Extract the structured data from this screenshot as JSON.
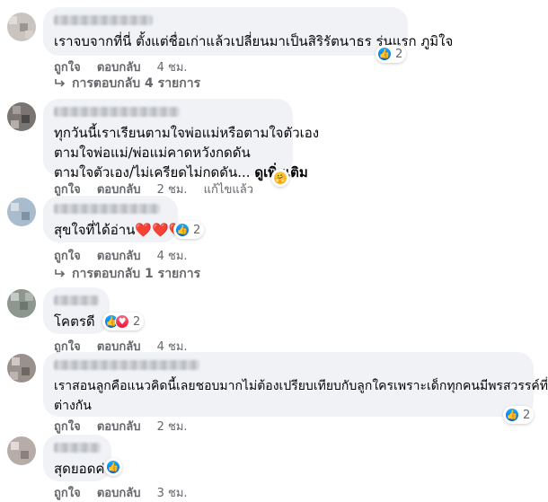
{
  "comments": [
    {
      "lines": [
        "เราจบจากที่นี่ ตั้งแต่ชื่อเก่าแล้วเปลี่ยนมาเป็นสิริรัตนาธร รุ่นแรก ภูมิใจ"
      ],
      "see_more": "",
      "reactions": {
        "icons": [
          "like"
        ],
        "count": "2"
      },
      "like": "ถูกใจ",
      "reply": "ตอบกลับ",
      "time": "4 ชม.",
      "edited": "",
      "replies": "การตอบกลับ 4 รายการ"
    },
    {
      "lines": [
        "ทุกวันนี้เราเรียนตามใจพ่อแม่หรือตามใจตัวเอง",
        "ตามใจพ่อแม่/พ่อแม่คาดหวังกดดัน",
        "ตามใจตัวเอง/ไม่เครียดไม่กดดัน... "
      ],
      "see_more": "ดูเพิ่มเติม",
      "reactions": {
        "icons": [
          "care"
        ],
        "count": ""
      },
      "like": "ถูกใจ",
      "reply": "ตอบกลับ",
      "time": "2 ชม.",
      "edited": "แก้ไขแล้ว",
      "replies": ""
    },
    {
      "lines": [
        "สุขใจที่ได้อ่าน❤️❤️❤️"
      ],
      "see_more": "",
      "reactions": {
        "icons": [
          "like"
        ],
        "count": "2"
      },
      "like": "ถูกใจ",
      "reply": "ตอบกลับ",
      "time": "4 ชม.",
      "edited": "",
      "replies": "การตอบกลับ 1 รายการ"
    },
    {
      "lines": [
        "โคตรดี"
      ],
      "see_more": "",
      "reactions": {
        "icons": [
          "like",
          "love"
        ],
        "count": "2"
      },
      "like": "ถูกใจ",
      "reply": "ตอบกลับ",
      "time": "4 ชม.",
      "edited": "",
      "replies": ""
    },
    {
      "lines": [
        "เราสอนลูกคือแนวคิดนี้เลยชอบมากไม่ต้องเปรียบเทียบกับลูกใครเพราะเด็กทุกคนมีพรสวรรค์ที่",
        "ต่างกัน"
      ],
      "see_more": "",
      "reactions": {
        "icons": [
          "like"
        ],
        "count": "2"
      },
      "like": "ถูกใจ",
      "reply": "ตอบกลับ",
      "time": "2 ชม.",
      "edited": "",
      "replies": ""
    },
    {
      "lines": [
        "สุดยอดค่ะ"
      ],
      "see_more": "",
      "reactions": {
        "icons": [
          "like"
        ],
        "count": ""
      },
      "like": "ถูกใจ",
      "reply": "ตอบกลับ",
      "time": "3 ชม.",
      "edited": "",
      "replies": ""
    }
  ],
  "colors": {
    "bubble": "#f0f2f5",
    "meta": "#65676b",
    "like_blue": "#1877f2",
    "love_red": "#f33e58",
    "care_yellow": "#f7b928"
  },
  "icons": {
    "like": "thumbs-up-icon",
    "love": "heart-icon",
    "care": "care-hug-icon",
    "reply_arrow": "reply-arrow-icon"
  }
}
